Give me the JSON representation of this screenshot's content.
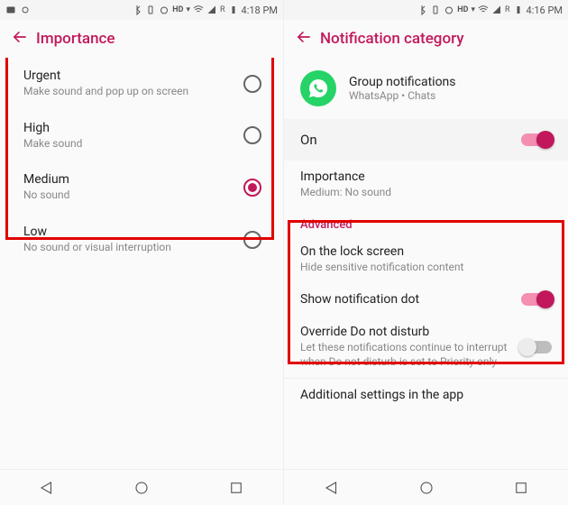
{
  "colors": {
    "accent": "#c2185b"
  },
  "left": {
    "status": {
      "time": "4:18 PM",
      "hd": "HD",
      "net": "R"
    },
    "title": "Importance",
    "options": [
      {
        "title": "Urgent",
        "sub": "Make sound and pop up on screen",
        "selected": false
      },
      {
        "title": "High",
        "sub": "Make sound",
        "selected": false
      },
      {
        "title": "Medium",
        "sub": "No sound",
        "selected": true
      },
      {
        "title": "Low",
        "sub": "No sound or visual interruption",
        "selected": false
      }
    ]
  },
  "right": {
    "status": {
      "time": "4:16 PM",
      "hd": "HD",
      "net": "R"
    },
    "title": "Notification category",
    "header": {
      "name": "Group notifications",
      "source": "WhatsApp • Chats"
    },
    "master": {
      "label": "On",
      "on": true
    },
    "importance": {
      "title": "Importance",
      "value": "Medium: No sound"
    },
    "advanced_label": "Advanced",
    "lockscreen": {
      "title": "On the lock screen",
      "sub": "Hide sensitive notification content"
    },
    "dot": {
      "title": "Show notification dot",
      "on": true
    },
    "dnd": {
      "title": "Override Do not disturb",
      "sub": "Let these notifications continue to interrupt when Do not disturb is set to Priority only",
      "on": false
    },
    "additional": "Additional settings in the app"
  }
}
